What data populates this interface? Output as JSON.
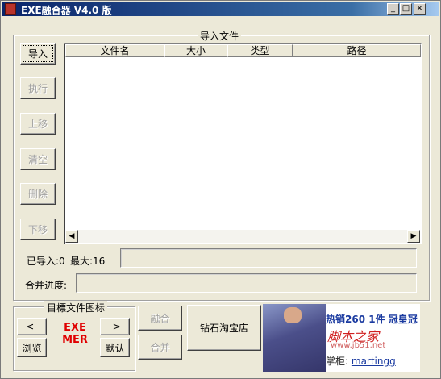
{
  "window": {
    "title": "EXE融合器 V4.0 版"
  },
  "import_group": {
    "title": "导入文件"
  },
  "buttons": {
    "import": "导入",
    "execute": "执行",
    "move_up": "上移",
    "clear": "清空",
    "delete": "删除",
    "move_down": "下移",
    "merge": "融合",
    "combine": "合并",
    "shop": "钻石淘宝店"
  },
  "table": {
    "columns": [
      "文件名",
      "大小",
      "类型",
      "路径"
    ]
  },
  "status": {
    "imported": "已导入:0",
    "max": "最大:16"
  },
  "progress_label": "合并进度:",
  "icon_group": {
    "title": "目標文件图标",
    "prev": "<-",
    "next": "->",
    "browse": "浏览",
    "default": "默认",
    "icon_line1": "EXE",
    "icon_line2": "MER"
  },
  "banner": {
    "line1": "热销260 1件 冠皇冠",
    "line2": "脚本之家",
    "line3": "www.jb51.net",
    "line4_label": "掌柜:",
    "line4_link": "martingg"
  }
}
